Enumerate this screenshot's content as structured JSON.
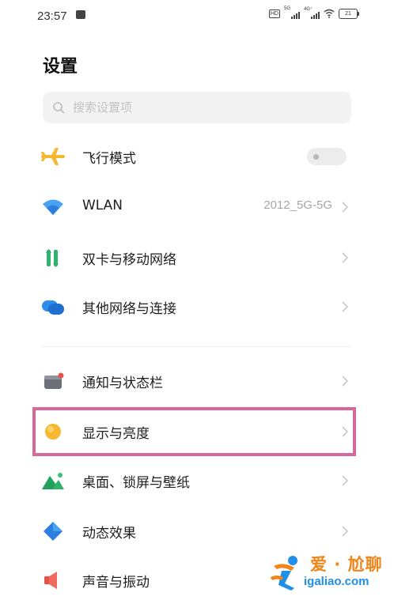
{
  "status_bar": {
    "time": "23:57",
    "hd_label": "HD",
    "signal_1_label": "5G",
    "signal_2_label": "4G⁺",
    "battery": "21"
  },
  "page": {
    "title": "设置"
  },
  "search": {
    "placeholder": "搜索设置项"
  },
  "settings_items": [
    {
      "label": "飞行模式",
      "icon": "airplane-icon",
      "toggle_on": false
    },
    {
      "label": "WLAN",
      "icon": "wifi-icon",
      "value": "2012_5G-5G"
    },
    {
      "label": "双卡与移动网络",
      "icon": "dual-sim-icon"
    },
    {
      "label": "其他网络与连接",
      "icon": "connections-icon"
    },
    {
      "label": "通知与状态栏",
      "icon": "notification-icon"
    },
    {
      "label": "显示与亮度",
      "icon": "brightness-icon"
    },
    {
      "label": "桌面、锁屏与壁纸",
      "icon": "wallpaper-icon"
    },
    {
      "label": "动态效果",
      "icon": "animation-icon"
    },
    {
      "label": "声音与振动",
      "icon": "sound-icon"
    }
  ],
  "colors": {
    "highlight": "#d8689a",
    "airplane": "#f5b82e",
    "wifi": "#2d8de8",
    "sim": "#2fb36a",
    "brightness": "#f6b731"
  },
  "watermark": {
    "brand": "爱 · 尬聊",
    "site": "igaliao.com"
  }
}
